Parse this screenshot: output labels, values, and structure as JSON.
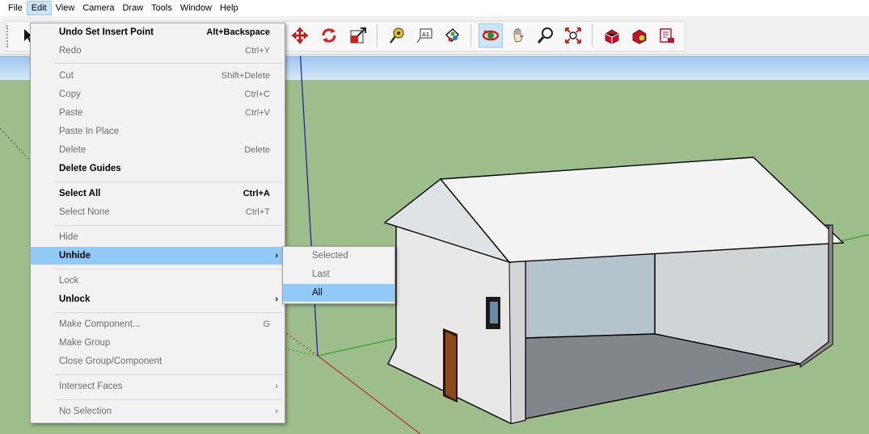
{
  "menubar": {
    "items": [
      "File",
      "Edit",
      "View",
      "Camera",
      "Draw",
      "Tools",
      "Window",
      "Help"
    ]
  },
  "edit_menu": {
    "items": [
      {
        "label": "Undo Set Insert Point",
        "shortcut": "Alt+Backspace",
        "state": "enabled"
      },
      {
        "label": "Redo",
        "shortcut": "Ctrl+Y",
        "state": "disabled"
      },
      {
        "label": "Cut",
        "shortcut": "Shift+Delete",
        "state": "disabled"
      },
      {
        "label": "Copy",
        "shortcut": "Ctrl+C",
        "state": "disabled"
      },
      {
        "label": "Paste",
        "shortcut": "Ctrl+V",
        "state": "disabled"
      },
      {
        "label": "Paste In Place",
        "shortcut": "",
        "state": "disabled"
      },
      {
        "label": "Delete",
        "shortcut": "Delete",
        "state": "disabled"
      },
      {
        "label": "Delete Guides",
        "shortcut": "",
        "state": "enabled"
      },
      {
        "label": "Select All",
        "shortcut": "Ctrl+A",
        "state": "enabled"
      },
      {
        "label": "Select None",
        "shortcut": "Ctrl+T",
        "state": "disabled"
      },
      {
        "label": "Hide",
        "shortcut": "",
        "state": "disabled"
      },
      {
        "label": "Unhide",
        "shortcut": "",
        "state": "highlighted",
        "submenu": true
      },
      {
        "label": "Lock",
        "shortcut": "",
        "state": "disabled"
      },
      {
        "label": "Unlock",
        "shortcut": "",
        "state": "enabled",
        "submenu": true
      },
      {
        "label": "Make Component...",
        "shortcut": "G",
        "state": "disabled"
      },
      {
        "label": "Make Group",
        "shortcut": "",
        "state": "disabled"
      },
      {
        "label": "Close Group/Component",
        "shortcut": "",
        "state": "disabled"
      },
      {
        "label": "Intersect Faces",
        "shortcut": "",
        "state": "disabled",
        "submenu": true
      },
      {
        "label": "No Selection",
        "shortcut": "",
        "state": "disabled",
        "submenu": true
      }
    ]
  },
  "unhide_submenu": {
    "items": [
      {
        "label": "Selected",
        "state": "disabled"
      },
      {
        "label": "Last",
        "state": "disabled"
      },
      {
        "label": "All",
        "state": "highlighted"
      }
    ]
  },
  "colors": {
    "sky": "#a5c8ef",
    "ground": "#9dbd8b",
    "menu_bg": "#f2f2f2",
    "menu_highlight": "#91c9f7",
    "house_wall": "#e8e8e8",
    "door": "#8b4a1c"
  },
  "toolbar": {
    "icons": [
      "select-arrow-icon",
      "move-icon",
      "rotate-icon",
      "scale-icon",
      "tape-measure-icon",
      "text-label-icon",
      "paint-bucket-icon",
      "orbit-icon",
      "pan-icon",
      "zoom-icon",
      "zoom-extents-icon",
      "warehouse-icon",
      "extension-warehouse-icon",
      "send-to-layout-icon"
    ],
    "active": "orbit-icon"
  }
}
